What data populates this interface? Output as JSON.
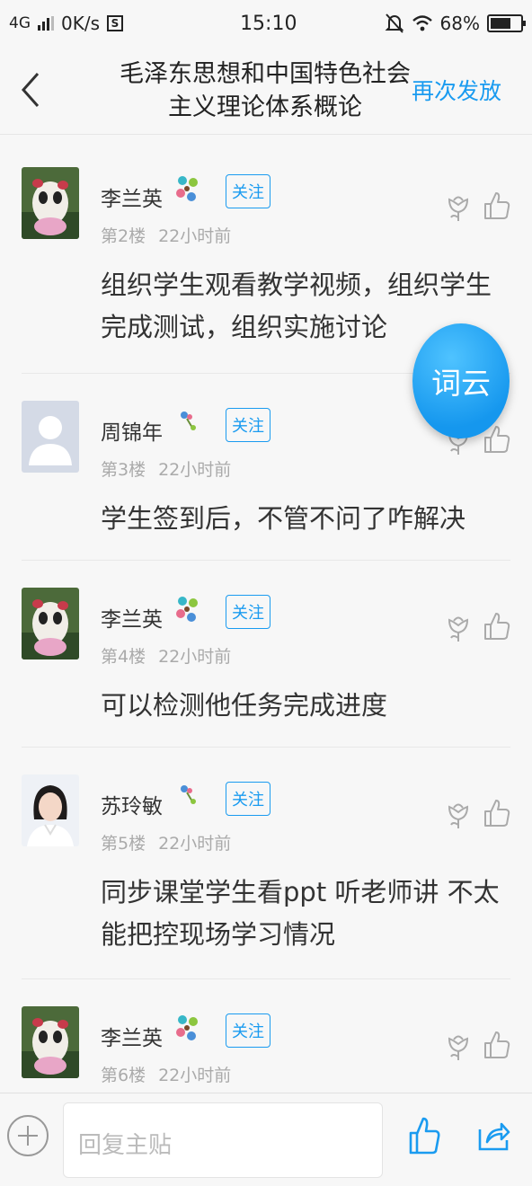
{
  "status": {
    "network": "4G",
    "speed": "0K/s",
    "sync_icon": "S",
    "time": "15:10",
    "battery": "68%",
    "battery_level": 0.68
  },
  "nav": {
    "title": "毛泽东思想和中国特色社会主义理论体系概论",
    "action": "再次发放",
    "back_icon": "chevron-left-icon"
  },
  "fab_label": "词云",
  "follow_label": "关注",
  "posts": [
    {
      "author": "李兰英",
      "floor": "第2楼",
      "time": "22小时前",
      "content": "组织学生观看教学视频，组织学生完成测试，组织实施讨论",
      "avatar": "panda-avatar",
      "badge": "flower-cluster-badge"
    },
    {
      "author": "周锦年",
      "floor": "第3楼",
      "time": "22小时前",
      "content": "学生签到后，不管不问了咋解决",
      "avatar": "default-person-avatar",
      "badge": "single-flower-badge"
    },
    {
      "author": "李兰英",
      "floor": "第4楼",
      "time": "22小时前",
      "content": "可以检测他任务完成进度",
      "avatar": "panda-avatar",
      "badge": "flower-cluster-badge"
    },
    {
      "author": "苏玲敏",
      "floor": "第5楼",
      "time": "22小时前",
      "content": "同步课堂学生看ppt 听老师讲  不太能把控现场学习情况",
      "avatar": "photo-avatar",
      "badge": "single-flower-badge"
    },
    {
      "author": "李兰英",
      "floor": "第6楼",
      "time": "22小时前",
      "content": "",
      "avatar": "panda-avatar",
      "badge": "flower-cluster-badge"
    }
  ],
  "bottom": {
    "reply_placeholder": "回复主贴"
  },
  "colors": {
    "accent": "#1a9bf0",
    "fab": "#1597ee",
    "muted": "#aaaaaa"
  }
}
